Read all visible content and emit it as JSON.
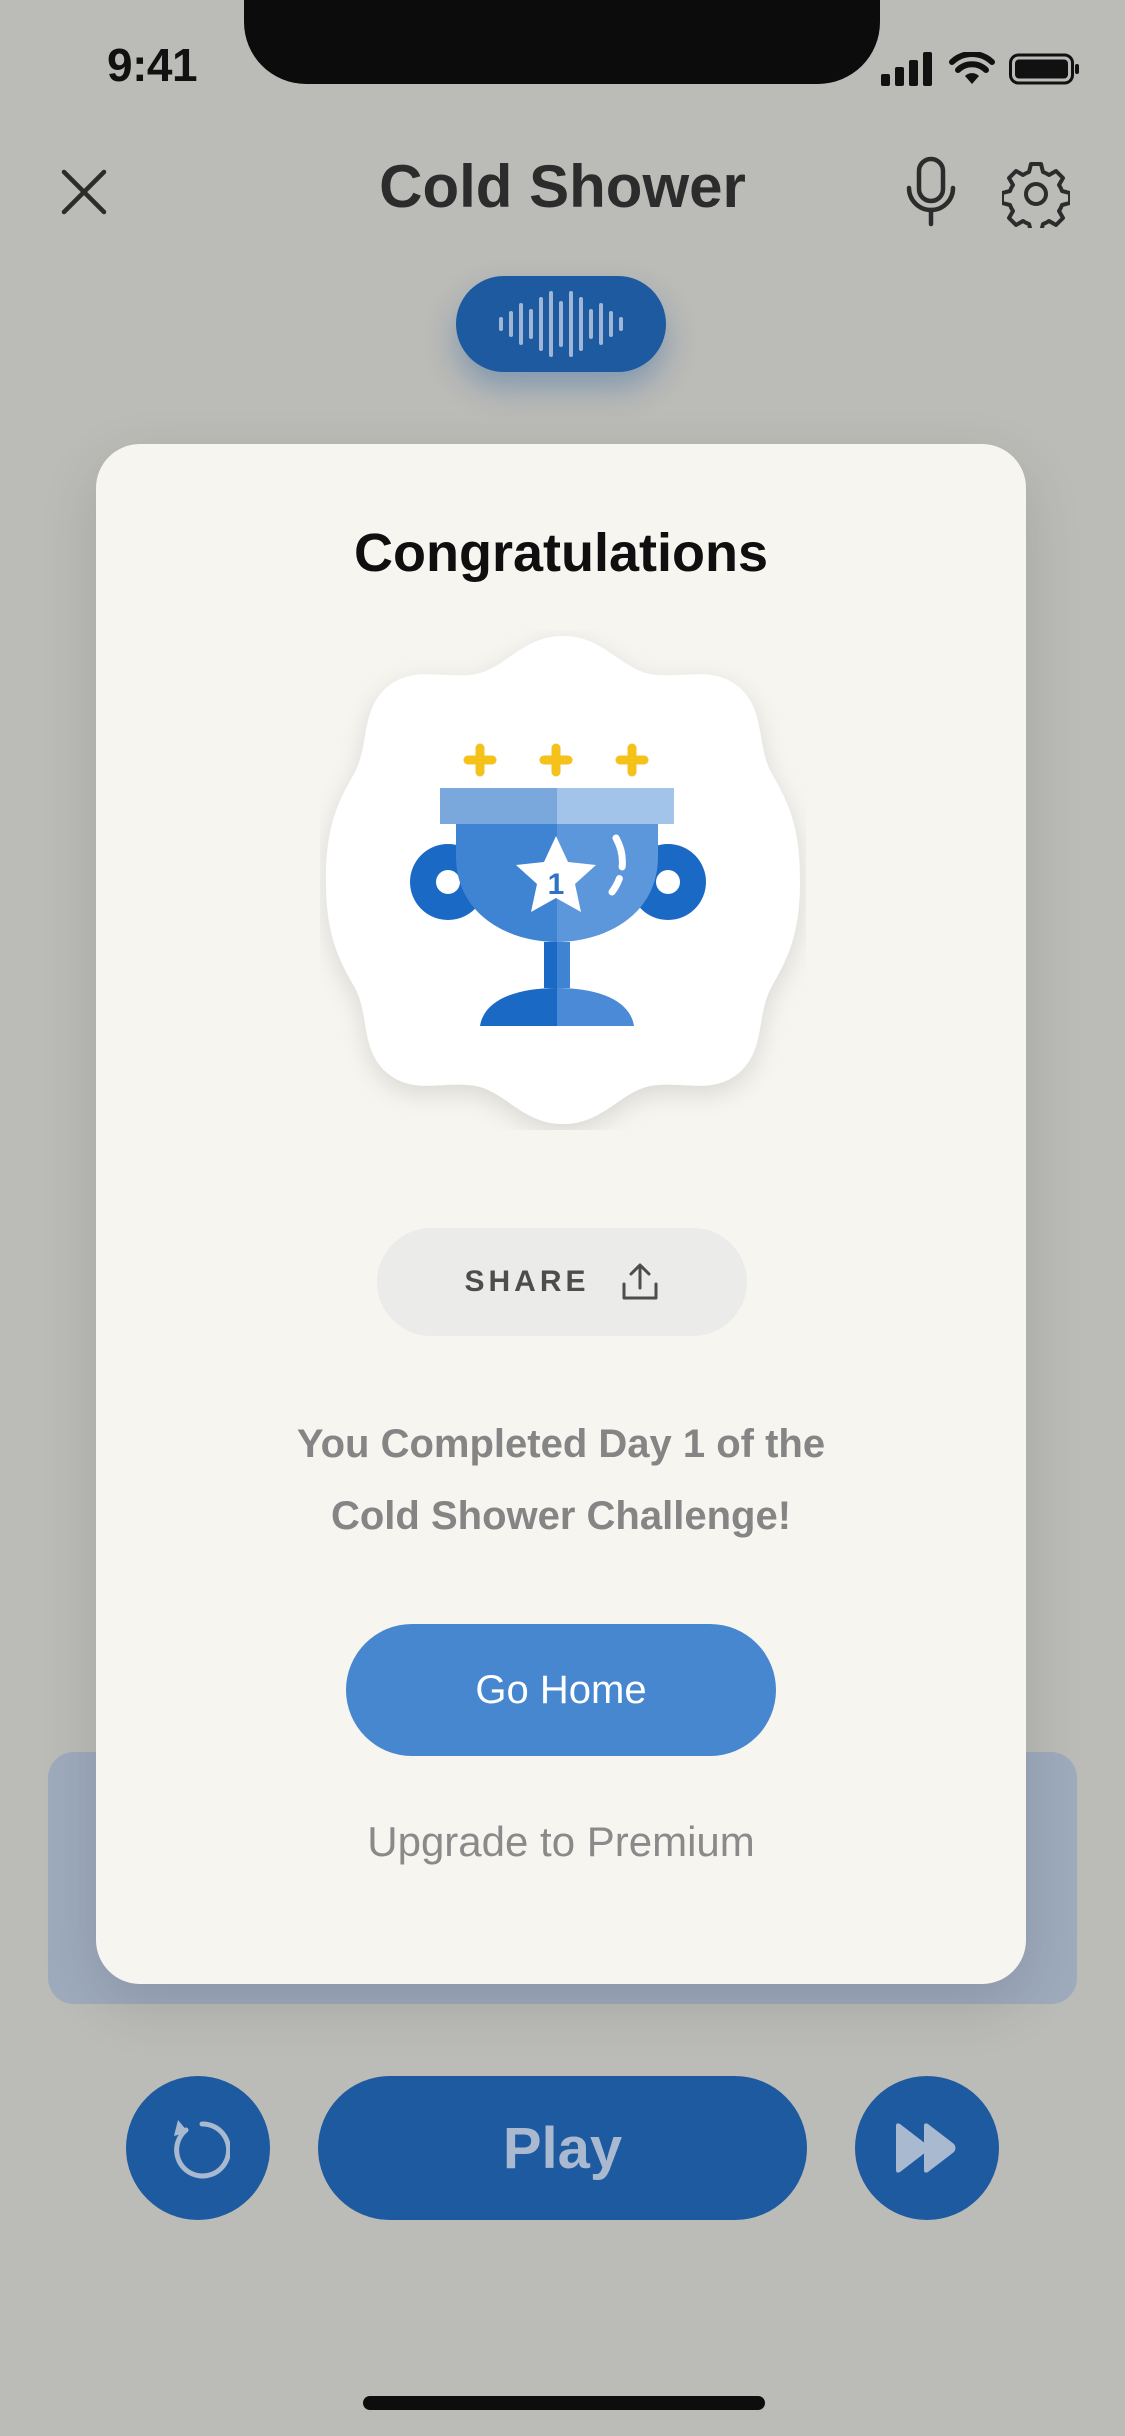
{
  "status_bar": {
    "time": "9:41"
  },
  "header": {
    "title": "Cold Shower"
  },
  "modal": {
    "title": "Congratulations",
    "badge_number": "1",
    "share_label": "SHARE",
    "message_line1": "You Completed Day 1 of the",
    "message_line2": "Cold Shower Challenge!",
    "primary_button": "Go Home",
    "secondary_link": "Upgrade to Premium"
  },
  "controls": {
    "play_label": "Play"
  },
  "colors": {
    "accent": "#1e5aa0",
    "button_blue": "#4787cf",
    "trophy_gold": "#f5c21b",
    "modal_bg": "#f7f5f0",
    "overlay_bg": "#bbbbb7"
  }
}
